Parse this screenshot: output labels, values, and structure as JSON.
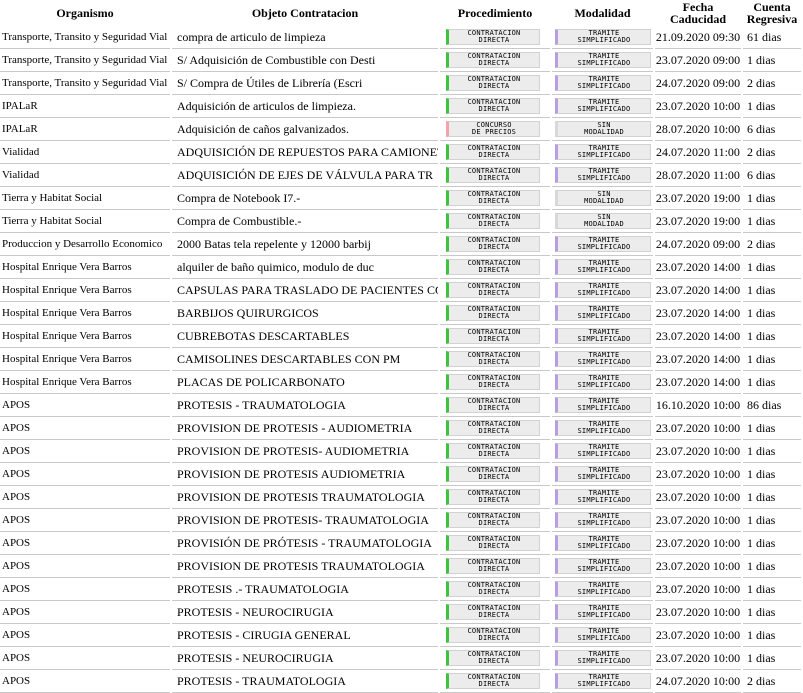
{
  "headers": {
    "organismo": "Organismo",
    "objeto": "Objeto Contratacion",
    "procedimiento": "Procedimiento",
    "modalidad": "Modalidad",
    "fecha": "Fecha Caducidad",
    "cuenta_l1": "Cuenta",
    "cuenta_l2": "Regresiva"
  },
  "badge_colors": {
    "green": "#3fc33f",
    "pink": "#f2a4ad",
    "purple": "#b89ee0",
    "gray": "#d8d8d8"
  },
  "rows": [
    {
      "organismo": "Transporte, Transito y Seguridad Vial",
      "objeto": "compra de articulo de limpieza",
      "proc": [
        "CONTRATACION",
        "DIRECTA"
      ],
      "proc_color": "green",
      "mod": [
        "TRAMITE",
        "SIMPLIFICADO"
      ],
      "mod_color": "purple",
      "fecha": "21.09.2020 09:30",
      "cuenta": "61 dias"
    },
    {
      "organismo": "Transporte, Transito y Seguridad Vial",
      "objeto": "S/ Adquisición de Combustible con Desti",
      "proc": [
        "CONTRATACION",
        "DIRECTA"
      ],
      "proc_color": "green",
      "mod": [
        "TRAMITE",
        "SIMPLIFICADO"
      ],
      "mod_color": "purple",
      "fecha": "23.07.2020 09:00",
      "cuenta": "1 dias"
    },
    {
      "organismo": "Transporte, Transito y Seguridad Vial",
      "objeto": "S/ Compra de Útiles de Librería (Escri",
      "proc": [
        "CONTRATACION",
        "DIRECTA"
      ],
      "proc_color": "green",
      "mod": [
        "TRAMITE",
        "SIMPLIFICADO"
      ],
      "mod_color": "purple",
      "fecha": "24.07.2020 09:00",
      "cuenta": "2 dias"
    },
    {
      "organismo": "IPALaR",
      "objeto": "Adquisición de articulos de limpieza.",
      "proc": [
        "CONTRATACION",
        "DIRECTA"
      ],
      "proc_color": "green",
      "mod": [
        "TRAMITE",
        "SIMPLIFICADO"
      ],
      "mod_color": "purple",
      "fecha": "23.07.2020 10:00",
      "cuenta": "1 dias"
    },
    {
      "organismo": "IPALaR",
      "objeto": "Adquisición de caños galvanizados.",
      "proc": [
        "CONCURSO",
        "DE PRECIOS"
      ],
      "proc_color": "pink",
      "mod": [
        "SIN",
        "MODALIDAD"
      ],
      "mod_color": "gray",
      "fecha": "28.07.2020 10:00",
      "cuenta": "6 dias"
    },
    {
      "organismo": "Vialidad",
      "objeto": "ADQUISICIÓN DE REPUESTOS PARA CAMIONETA",
      "proc": [
        "CONTRATACION",
        "DIRECTA"
      ],
      "proc_color": "green",
      "mod": [
        "TRAMITE",
        "SIMPLIFICADO"
      ],
      "mod_color": "purple",
      "fecha": "24.07.2020 11:00",
      "cuenta": "2 dias"
    },
    {
      "organismo": "Vialidad",
      "objeto": "ADQUISICIÓN DE EJES DE VÁLVULA PARA TR",
      "proc": [
        "CONTRATACION",
        "DIRECTA"
      ],
      "proc_color": "green",
      "mod": [
        "TRAMITE",
        "SIMPLIFICADO"
      ],
      "mod_color": "purple",
      "fecha": "28.07.2020 11:00",
      "cuenta": "6 dias"
    },
    {
      "organismo": "Tierra y Habitat Social",
      "objeto": "Compra de Notebook I7.-",
      "proc": [
        "CONTRATACION",
        "DIRECTA"
      ],
      "proc_color": "green",
      "mod": [
        "SIN",
        "MODALIDAD"
      ],
      "mod_color": "gray",
      "fecha": "23.07.2020 19:00",
      "cuenta": "1 dias"
    },
    {
      "organismo": "Tierra y Habitat Social",
      "objeto": "Compra de Combustible.-",
      "proc": [
        "CONTRATACION",
        "DIRECTA"
      ],
      "proc_color": "green",
      "mod": [
        "SIN",
        "MODALIDAD"
      ],
      "mod_color": "gray",
      "fecha": "23.07.2020 19:00",
      "cuenta": "1 dias"
    },
    {
      "organismo": "Produccion y Desarrollo Economico",
      "objeto": "2000 Batas tela repelente y 12000 barbij",
      "proc": [
        "CONTRATACION",
        "DIRECTA"
      ],
      "proc_color": "green",
      "mod": [
        "TRAMITE",
        "SIMPLIFICADO"
      ],
      "mod_color": "purple",
      "fecha": "24.07.2020 09:00",
      "cuenta": "2 dias"
    },
    {
      "organismo": "Hospital Enrique Vera Barros",
      "objeto": "alquiler de baño quimico, modulo de duc",
      "proc": [
        "CONTRATACION",
        "DIRECTA"
      ],
      "proc_color": "green",
      "mod": [
        "TRAMITE",
        "SIMPLIFICADO"
      ],
      "mod_color": "purple",
      "fecha": "23.07.2020 14:00",
      "cuenta": "1 dias"
    },
    {
      "organismo": "Hospital Enrique Vera Barros",
      "objeto": "CAPSULAS PARA TRASLADO DE PACIENTES COVI",
      "proc": [
        "CONTRATACION",
        "DIRECTA"
      ],
      "proc_color": "green",
      "mod": [
        "TRAMITE",
        "SIMPLIFICADO"
      ],
      "mod_color": "purple",
      "fecha": "23.07.2020 14:00",
      "cuenta": "1 dias"
    },
    {
      "organismo": "Hospital Enrique Vera Barros",
      "objeto": "BARBIJOS QUIRURGICOS",
      "proc": [
        "CONTRATACION",
        "DIRECTA"
      ],
      "proc_color": "green",
      "mod": [
        "TRAMITE",
        "SIMPLIFICADO"
      ],
      "mod_color": "purple",
      "fecha": "23.07.2020 14:00",
      "cuenta": "1 dias"
    },
    {
      "organismo": "Hospital Enrique Vera Barros",
      "objeto": "CUBREBOTAS DESCARTABLES",
      "proc": [
        "CONTRATACION",
        "DIRECTA"
      ],
      "proc_color": "green",
      "mod": [
        "TRAMITE",
        "SIMPLIFICADO"
      ],
      "mod_color": "purple",
      "fecha": "23.07.2020 14:00",
      "cuenta": "1 dias"
    },
    {
      "organismo": "Hospital Enrique Vera Barros",
      "objeto": "CAMISOLINES DESCARTABLES CON PM",
      "proc": [
        "CONTRATACION",
        "DIRECTA"
      ],
      "proc_color": "green",
      "mod": [
        "TRAMITE",
        "SIMPLIFICADO"
      ],
      "mod_color": "purple",
      "fecha": "23.07.2020 14:00",
      "cuenta": "1 dias"
    },
    {
      "organismo": "Hospital Enrique Vera Barros",
      "objeto": "PLACAS DE POLICARBONATO",
      "proc": [
        "CONTRATACION",
        "DIRECTA"
      ],
      "proc_color": "green",
      "mod": [
        "TRAMITE",
        "SIMPLIFICADO"
      ],
      "mod_color": "purple",
      "fecha": "23.07.2020 14:00",
      "cuenta": "1 dias"
    },
    {
      "organismo": "APOS",
      "objeto": "PROTESIS - TRAUMATOLOGIA",
      "proc": [
        "CONTRATACION",
        "DIRECTA"
      ],
      "proc_color": "green",
      "mod": [
        "TRAMITE",
        "SIMPLIFICADO"
      ],
      "mod_color": "purple",
      "fecha": "16.10.2020 10:00",
      "cuenta": "86 dias"
    },
    {
      "organismo": "APOS",
      "objeto": "PROVISION DE PROTESIS - AUDIOMETRIA",
      "proc": [
        "CONTRATACION",
        "DIRECTA"
      ],
      "proc_color": "green",
      "mod": [
        "TRAMITE",
        "SIMPLIFICADO"
      ],
      "mod_color": "purple",
      "fecha": "23.07.2020 10:00",
      "cuenta": "1 dias"
    },
    {
      "organismo": "APOS",
      "objeto": "PROVISION DE PROTESIS- AUDIOMETRIA",
      "proc": [
        "CONTRATACION",
        "DIRECTA"
      ],
      "proc_color": "green",
      "mod": [
        "TRAMITE",
        "SIMPLIFICADO"
      ],
      "mod_color": "purple",
      "fecha": "23.07.2020 10:00",
      "cuenta": "1 dias"
    },
    {
      "organismo": "APOS",
      "objeto": "PROVISION DE PROTESIS AUDIOMETRIA",
      "proc": [
        "CONTRATACION",
        "DIRECTA"
      ],
      "proc_color": "green",
      "mod": [
        "TRAMITE",
        "SIMPLIFICADO"
      ],
      "mod_color": "purple",
      "fecha": "23.07.2020 10:00",
      "cuenta": "1 dias"
    },
    {
      "organismo": "APOS",
      "objeto": "PROVISION DE PROTESIS TRAUMATOLOGIA",
      "proc": [
        "CONTRATACION",
        "DIRECTA"
      ],
      "proc_color": "green",
      "mod": [
        "TRAMITE",
        "SIMPLIFICADO"
      ],
      "mod_color": "purple",
      "fecha": "23.07.2020 10:00",
      "cuenta": "1 dias"
    },
    {
      "organismo": "APOS",
      "objeto": "PROVISION DE PROTESIS- TRAUMATOLOGIA",
      "proc": [
        "CONTRATACION",
        "DIRECTA"
      ],
      "proc_color": "green",
      "mod": [
        "TRAMITE",
        "SIMPLIFICADO"
      ],
      "mod_color": "purple",
      "fecha": "23.07.2020 10:00",
      "cuenta": "1 dias"
    },
    {
      "organismo": "APOS",
      "objeto": "PROVISIÓN DE PRÓTESIS - TRAUMATOLOGIA",
      "proc": [
        "CONTRATACION",
        "DIRECTA"
      ],
      "proc_color": "green",
      "mod": [
        "TRAMITE",
        "SIMPLIFICADO"
      ],
      "mod_color": "purple",
      "fecha": "23.07.2020 10:00",
      "cuenta": "1 dias"
    },
    {
      "organismo": "APOS",
      "objeto": "PROVISION DE PROTESIS TRAUMATOLOGIA",
      "proc": [
        "CONTRATACION",
        "DIRECTA"
      ],
      "proc_color": "green",
      "mod": [
        "TRAMITE",
        "SIMPLIFICADO"
      ],
      "mod_color": "purple",
      "fecha": "23.07.2020 10:00",
      "cuenta": "1 dias"
    },
    {
      "organismo": "APOS",
      "objeto": "PROTESIS .- TRAUMATOLOGIA",
      "proc": [
        "CONTRATACION",
        "DIRECTA"
      ],
      "proc_color": "green",
      "mod": [
        "TRAMITE",
        "SIMPLIFICADO"
      ],
      "mod_color": "purple",
      "fecha": "23.07.2020 10:00",
      "cuenta": "1 dias"
    },
    {
      "organismo": "APOS",
      "objeto": "PROTESIS - NEUROCIRUGIA",
      "proc": [
        "CONTRATACION",
        "DIRECTA"
      ],
      "proc_color": "green",
      "mod": [
        "TRAMITE",
        "SIMPLIFICADO"
      ],
      "mod_color": "purple",
      "fecha": "23.07.2020 10:00",
      "cuenta": "1 dias"
    },
    {
      "organismo": "APOS",
      "objeto": "PROTESIS - CIRUGIA GENERAL",
      "proc": [
        "CONTRATACION",
        "DIRECTA"
      ],
      "proc_color": "green",
      "mod": [
        "TRAMITE",
        "SIMPLIFICADO"
      ],
      "mod_color": "purple",
      "fecha": "23.07.2020 10:00",
      "cuenta": "1 dias"
    },
    {
      "organismo": "APOS",
      "objeto": "PROTESIS - NEUROCIRUGIA",
      "proc": [
        "CONTRATACION",
        "DIRECTA"
      ],
      "proc_color": "green",
      "mod": [
        "TRAMITE",
        "SIMPLIFICADO"
      ],
      "mod_color": "purple",
      "fecha": "23.07.2020 10:00",
      "cuenta": "1 dias"
    },
    {
      "organismo": "APOS",
      "objeto": "PROTESIS - TRAUMATOLOGIA",
      "proc": [
        "CONTRATACION",
        "DIRECTA"
      ],
      "proc_color": "green",
      "mod": [
        "TRAMITE",
        "SIMPLIFICADO"
      ],
      "mod_color": "purple",
      "fecha": "24.07.2020 10:00",
      "cuenta": "2 dias"
    }
  ]
}
